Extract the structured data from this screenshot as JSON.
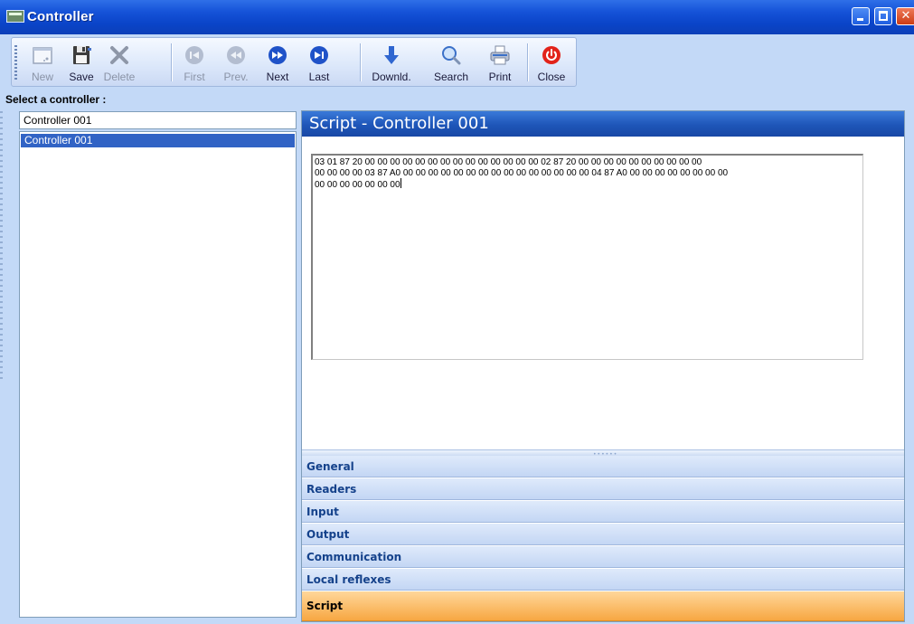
{
  "window": {
    "title": "Controller",
    "min_icon": "minimize-icon",
    "max_icon": "maximize-icon",
    "close_icon": "close-x-icon"
  },
  "toolbar": {
    "buttons": [
      {
        "label": "New",
        "icon": "new-document-icon",
        "enabled": false
      },
      {
        "label": "Save",
        "icon": "save-icon",
        "enabled": true
      },
      {
        "label": "Delete",
        "icon": "delete-x-icon",
        "enabled": false
      },
      {
        "label": "First",
        "icon": "first-record-icon",
        "enabled": false
      },
      {
        "label": "Prev.",
        "icon": "previous-record-icon",
        "enabled": false
      },
      {
        "label": "Next",
        "icon": "next-record-icon",
        "enabled": true
      },
      {
        "label": "Last",
        "icon": "last-record-icon",
        "enabled": true
      },
      {
        "label": "Downld.",
        "icon": "download-arrow-icon",
        "enabled": true
      },
      {
        "label": "Search",
        "icon": "magnifier-icon",
        "enabled": true
      },
      {
        "label": "Print",
        "icon": "printer-icon",
        "enabled": true
      },
      {
        "label": "Close",
        "icon": "power-close-icon",
        "enabled": true
      }
    ]
  },
  "left": {
    "select_label": "Select a controller :",
    "combo_value": "Controller 001",
    "list": [
      {
        "label": "Controller 001",
        "selected": true
      }
    ]
  },
  "right": {
    "header": "Script - Controller 001",
    "script_lines": [
      "03 01 87 20 00 00 00 00 00 00 00 00 00 00 00 00 00 00 02 87 20 00 00 00 00 00 00 00 00 00 00",
      "00 00 00 00 03 87 A0 00 00 00 00 00 00 00 00 00 00 00 00 00 00 00 04 87 A0 00 00 00 00 00 00 00 00",
      "00 00 00 00 00 00 00"
    ],
    "nav_items": [
      {
        "label": "General",
        "active": false
      },
      {
        "label": "Readers",
        "active": false
      },
      {
        "label": "Input",
        "active": false
      },
      {
        "label": "Output",
        "active": false
      },
      {
        "label": "Communication",
        "active": false
      },
      {
        "label": "Local reflexes",
        "active": false
      },
      {
        "label": "Script",
        "active": true
      }
    ]
  },
  "colors": {
    "accent": "#1e55b8",
    "active_tab": "#f7a742",
    "selection": "#3163c5",
    "nav_text": "#15428b"
  }
}
